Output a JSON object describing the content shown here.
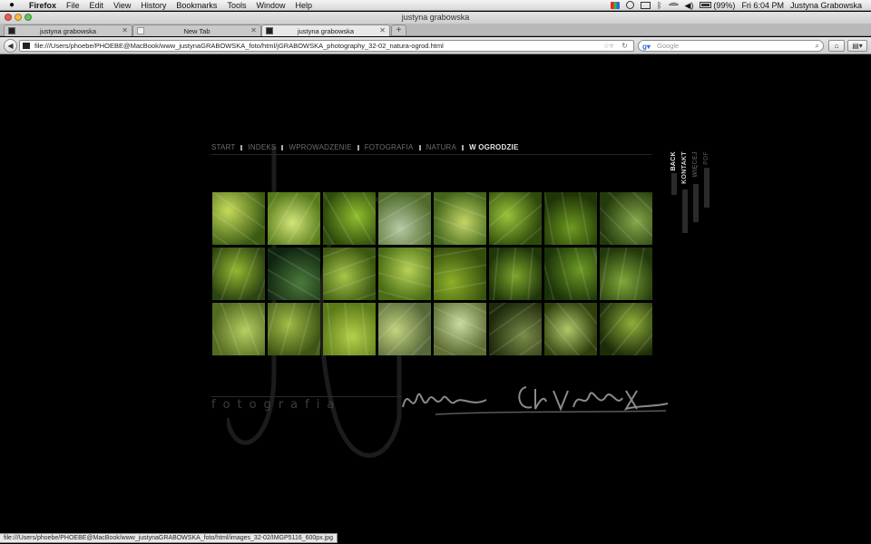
{
  "menubar": {
    "app": "Firefox",
    "items": [
      "File",
      "Edit",
      "View",
      "History",
      "Bookmarks",
      "Tools",
      "Window",
      "Help"
    ],
    "battery_pct": "(99%)",
    "battery_level": 0.99,
    "clock": "Fri 6:04 PM",
    "user": "Justyna Grabowska"
  },
  "window": {
    "title": "justyna grabowska"
  },
  "tabs": [
    {
      "label": "justyna grabowska",
      "close": "✕"
    },
    {
      "label": "New Tab",
      "close": "✕"
    },
    {
      "label": "justyna grabowska",
      "close": "✕"
    }
  ],
  "newtab_label": "+",
  "nav": {
    "url": "file:///Users/phoebe/PHOEBE@MacBook/www_justynaGRABOWSKA_foto/html/jGRABOWSKA_photography_32-02_natura-ogrod.html",
    "search_placeholder": "Google"
  },
  "site": {
    "menu": [
      "START",
      "INDEKS",
      "WPROWADZENIE",
      "FOTOGRAFIA",
      "NATURA"
    ],
    "current": "W OGRODZIE",
    "side_menu": [
      {
        "label": "BACK",
        "color": "#e6e6e6"
      },
      {
        "label": "KONTAKT",
        "color": "#d0d0d0"
      },
      {
        "label": "WIĘCEJ",
        "color": "#4c4c4c"
      },
      {
        "label": "PDF",
        "color": "#3c3c3c"
      }
    ],
    "tagline": "fotografia",
    "signature": "Justyna Grabowska",
    "photos": [
      {
        "c1": "#c5db5a",
        "c2": "#3c5b12",
        "ang": "35deg"
      },
      {
        "c1": "#d3e67a",
        "c2": "#567a1a",
        "ang": "120deg"
      },
      {
        "c1": "#8fbf2d",
        "c2": "#2f4a0c",
        "ang": "60deg"
      },
      {
        "c1": "#b6c9a4",
        "c2": "#4f6b2a",
        "ang": "150deg"
      },
      {
        "c1": "#c3d667",
        "c2": "#42651a",
        "ang": "20deg"
      },
      {
        "c1": "#9ac23a",
        "c2": "#2d4a0a",
        "ang": "140deg"
      },
      {
        "c1": "#6e9a20",
        "c2": "#1f3506",
        "ang": "80deg"
      },
      {
        "c1": "#86a84a",
        "c2": "#233a0c",
        "ang": "45deg"
      },
      {
        "c1": "#94b832",
        "c2": "#2c4410",
        "ang": "110deg"
      },
      {
        "c1": "#4c7a3a",
        "c2": "#0f2410",
        "ang": "30deg"
      },
      {
        "c1": "#a6c648",
        "c2": "#3a5610",
        "ang": "160deg"
      },
      {
        "c1": "#b8d258",
        "c2": "#496d14",
        "ang": "15deg"
      },
      {
        "c1": "#8db028",
        "c2": "#354e0c",
        "ang": "170deg"
      },
      {
        "c1": "#7ea52c",
        "c2": "#1e3608",
        "ang": "95deg"
      },
      {
        "c1": "#6c9a24",
        "c2": "#1a3207",
        "ang": "75deg"
      },
      {
        "c1": "#7fa83a",
        "c2": "#22380a",
        "ang": "100deg"
      },
      {
        "c1": "#b8cf62",
        "c2": "#536b20",
        "ang": "70deg"
      },
      {
        "c1": "#a3bc48",
        "c2": "#3d5514",
        "ang": "105deg"
      },
      {
        "c1": "#b6d04a",
        "c2": "#5b7a18",
        "ang": "85deg"
      },
      {
        "c1": "#c3d47e",
        "c2": "#56683a",
        "ang": "135deg"
      },
      {
        "c1": "#c9dca0",
        "c2": "#5e6e34",
        "ang": "25deg"
      },
      {
        "c1": "#7a8c48",
        "c2": "#1e2a0c",
        "ang": "145deg"
      },
      {
        "c1": "#b0c86a",
        "c2": "#2f3f0c",
        "ang": "50deg"
      },
      {
        "c1": "#8faf3a",
        "c2": "#1c2c08",
        "ang": "130deg"
      }
    ]
  },
  "status": "file:///Users/phoebe/PHOEBE@MacBook/www_justynaGRABOWSKA_foto/html/images_32-02/IMGP5116_600px.jpg",
  "colors": {
    "page_bg": "#000000",
    "accent_text": "#e5e5e5",
    "muted_text": "#6d6d6d"
  }
}
